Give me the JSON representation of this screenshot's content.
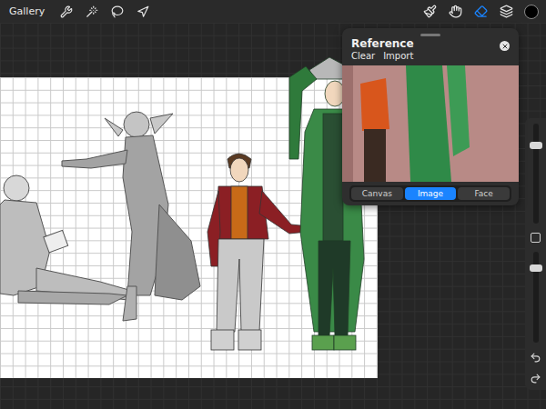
{
  "top_bar": {
    "gallery": "Gallery",
    "left_tools": [
      {
        "selected": false
      },
      {
        "selected": false
      },
      {
        "selected": false
      },
      {
        "selected": false
      }
    ],
    "right_tools": [
      {
        "selected": false
      },
      {
        "selected": false
      },
      {
        "selected": true
      },
      {
        "selected": false
      }
    ],
    "current_color": "#000000"
  },
  "reference": {
    "title": "Reference",
    "actions": [
      "Clear",
      "Import"
    ],
    "tabs": [
      {
        "label": "Canvas",
        "selected": false
      },
      {
        "label": "Image",
        "selected": true
      },
      {
        "label": "Face",
        "selected": false
      }
    ]
  },
  "sidebar": {
    "brush_size": {
      "level": 0.8
    },
    "opacity": {
      "level": 0.85
    }
  }
}
